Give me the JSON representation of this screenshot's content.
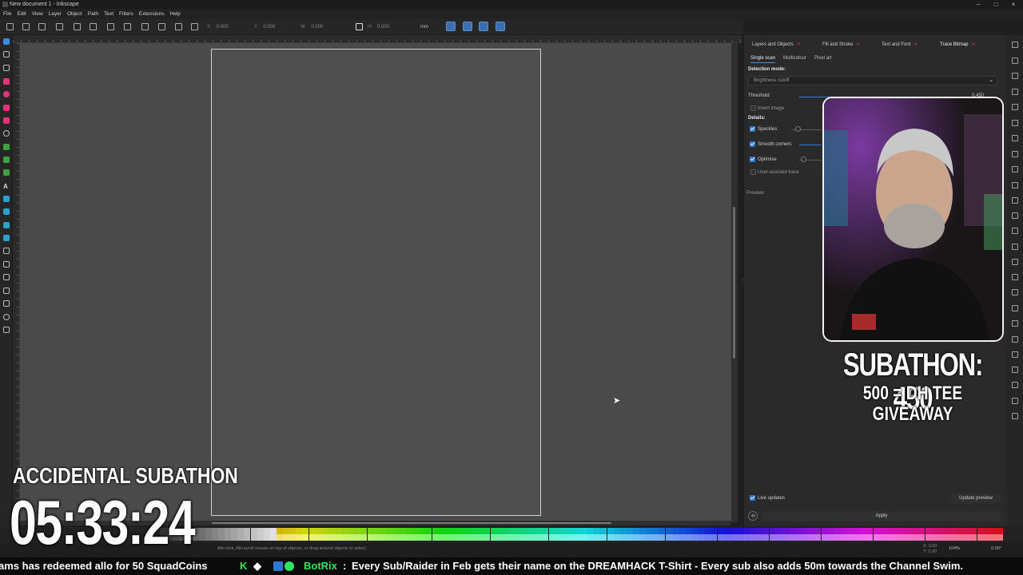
{
  "window": {
    "title": "New document 1 - Inkscape",
    "controls": [
      "−",
      "□",
      "×"
    ]
  },
  "menu": [
    "File",
    "Edit",
    "View",
    "Layer",
    "Object",
    "Path",
    "Text",
    "Filters",
    "Extensions",
    "Help"
  ],
  "command_bar": {
    "x_label": "X:",
    "x_value": "0.000",
    "y_label": "Y:",
    "y_value": "0.000",
    "w_label": "W:",
    "w_value": "0.000",
    "h_label": "H:",
    "h_value": "0.000",
    "unit": "mm"
  },
  "dock": {
    "tabs": [
      {
        "label": "Layers and Objects",
        "active": false
      },
      {
        "label": "Fill and Stroke",
        "active": false
      },
      {
        "label": "Text and Font",
        "active": false
      },
      {
        "label": "Trace Bitmap",
        "active": true
      }
    ],
    "subtabs": [
      "Single scan",
      "Multicolour",
      "Pixel art"
    ],
    "detection_mode_label": "Detection mode:",
    "detection_mode_value": "Brightness cutoff",
    "threshold_label": "Threshold",
    "threshold_value": "0.450",
    "invert_label": "Invert image",
    "details_label": "Details:",
    "speckles_label": "Speckles",
    "smooth_corners_label": "Smooth corners",
    "optimise_label": "Optimise",
    "user_assisted_label": "User-assisted trace",
    "preview_label": "Preview:",
    "live_updates_label": "Live updates",
    "update_preview_label": "Update preview",
    "apply_label": "Apply"
  },
  "statusbar": {
    "message": "Alt+click, Alt+scroll mouse on top of objects, or drag around objects to select.",
    "coord_x": "X: 0.00",
    "coord_y": "Y: 0.00",
    "zoom": "104%",
    "rotation": "0.00°"
  },
  "overlay": {
    "subathon_count": "SUBATHON: 450",
    "subathon_goal": "500 = DH TEE GIVEAWAY",
    "accidental_title": "ACCIDENTAL SUBATHON",
    "timer": "05:33:24"
  },
  "ticker": {
    "text1": "ams has redeemed allo for 50 SquadCoins",
    "bot_name": "BotRix",
    "bot_sep": ":",
    "text2": "Every Sub/Raider in Feb gets their name on the DREAMHACK T-Shirt - Every sub also adds 50m towards the Channel Swim."
  },
  "colors": {
    "canvas": "#4a4a4a",
    "accent": "#2f78d4",
    "ticker_green": "#2ee55d"
  }
}
